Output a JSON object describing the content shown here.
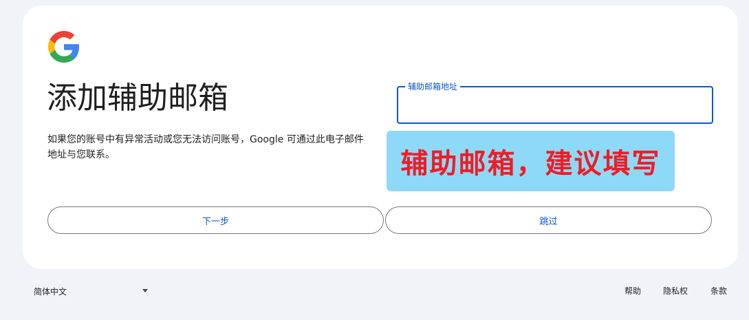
{
  "brand": {
    "logo_icon": "google-g-logo-icon",
    "colors": {
      "blue": "#4285F4",
      "red": "#EA4335",
      "yellow": "#FBBC05",
      "green": "#34A853",
      "accent": "#0b57d0"
    }
  },
  "main": {
    "title": "添加辅助邮箱",
    "description": "如果您的账号中有异常活动或您无法访问账号，Google 可通过此电子邮件地址与您联系。"
  },
  "email_field": {
    "label": "辅助邮箱地址",
    "value": ""
  },
  "annotation": {
    "text": "辅助邮箱，建议填写",
    "text_color": "#ef1c25",
    "background": "#8ed9f8"
  },
  "actions": {
    "next_label": "下一步",
    "skip_label": "跳过"
  },
  "footer": {
    "language": "简体中文",
    "language_icon": "caret-down-icon",
    "help": "帮助",
    "privacy": "隐私权",
    "terms": "条款"
  }
}
